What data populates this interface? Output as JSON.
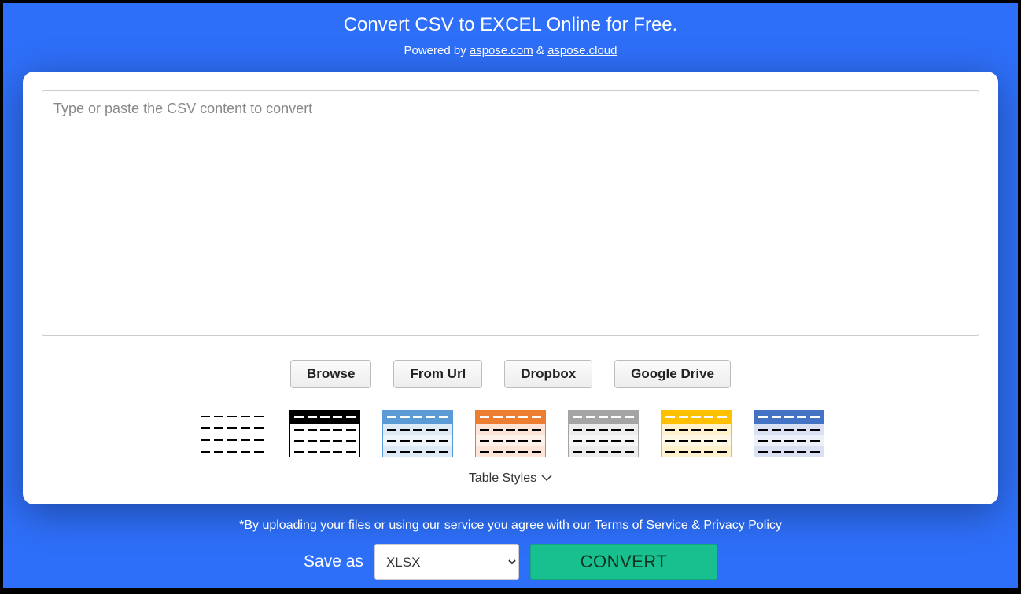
{
  "header": {
    "title": "Convert CSV to EXCEL Online for Free.",
    "powered_prefix": "Powered by ",
    "link1": "aspose.com",
    "amp": " & ",
    "link2": "aspose.cloud"
  },
  "textarea": {
    "placeholder": "Type or paste the CSV content to convert",
    "value": ""
  },
  "buttons": {
    "browse": "Browse",
    "from_url": "From Url",
    "dropbox": "Dropbox",
    "gdrive": "Google Drive"
  },
  "styles_label": "Table Styles",
  "disclaimer": {
    "prefix": "*By uploading your files or using our service you agree with our ",
    "tos": "Terms of Service",
    "amp": " & ",
    "pp": "Privacy Policy"
  },
  "save": {
    "label": "Save as",
    "selected": "XLSX",
    "options": [
      "XLSX"
    ]
  },
  "convert": "CONVERT",
  "style_options": [
    "none",
    "black",
    "blue",
    "orange",
    "gray",
    "gold",
    "blue2"
  ]
}
